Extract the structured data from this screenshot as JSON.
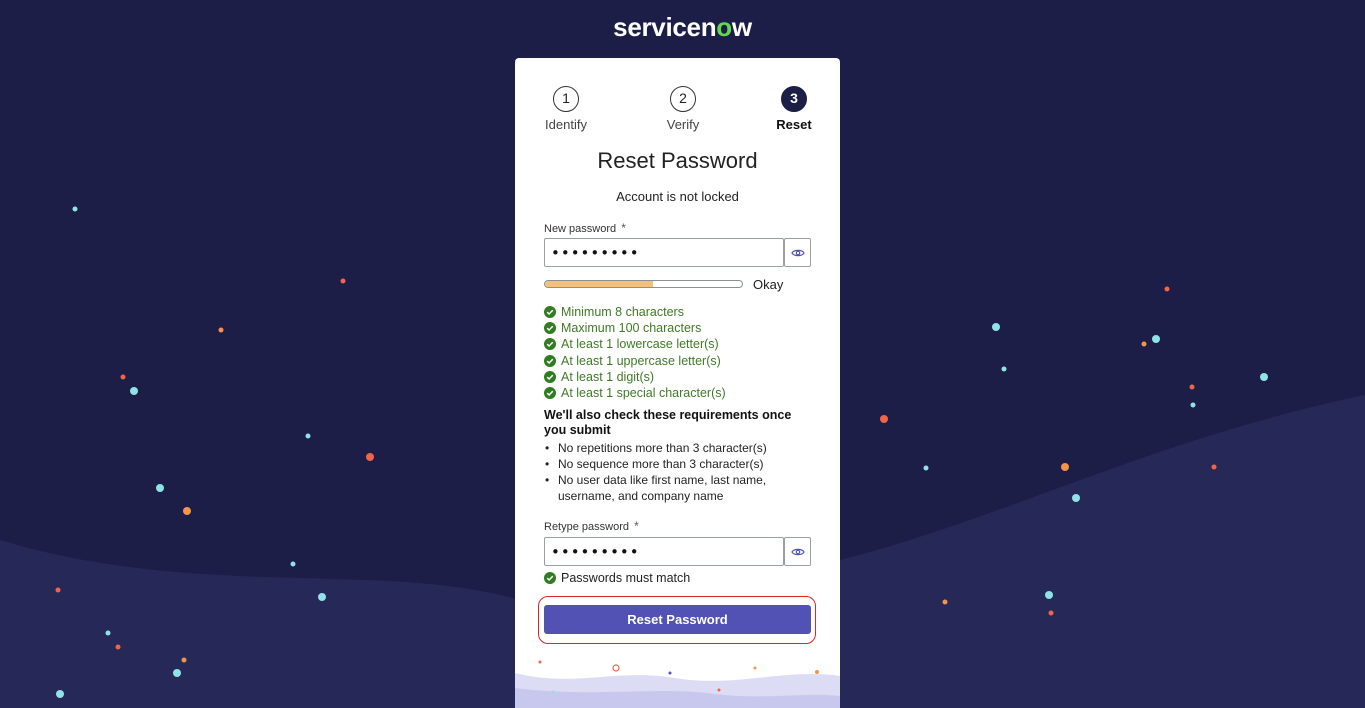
{
  "brand": {
    "name_prefix": "servicen",
    "name_o": "o",
    "name_suffix": "w",
    "accent": "#62d84e"
  },
  "colors": {
    "background": "#1c1e47",
    "button": "#5152b3",
    "check_text": "#3f7b26",
    "strength_fill": "#f3c27a",
    "highlight": "#e02424"
  },
  "steps": [
    {
      "number": "1",
      "label": "Identify",
      "active": false
    },
    {
      "number": "2",
      "label": "Verify",
      "active": false
    },
    {
      "number": "3",
      "label": "Reset",
      "active": true
    }
  ],
  "title": "Reset Password",
  "subtitle": "Account is not locked",
  "new_password": {
    "label": "New password",
    "required_mark": "*",
    "value": "•••••••••",
    "toggle_icon": "eye-icon"
  },
  "strength": {
    "fraction": 0.55,
    "label": "Okay"
  },
  "requirements": [
    {
      "text": "Minimum 8 characters",
      "met": true
    },
    {
      "text": "Maximum 100 characters",
      "met": true
    },
    {
      "text": "At least 1 lowercase letter(s)",
      "met": true
    },
    {
      "text": "At least 1 uppercase letter(s)",
      "met": true
    },
    {
      "text": "At least 1 digit(s)",
      "met": true
    },
    {
      "text": "At least 1 special character(s)",
      "met": true
    }
  ],
  "submit_checks_heading": "We'll also check these requirements once you submit",
  "submit_checks": [
    "No repetitions more than 3 character(s)",
    "No sequence more than 3 character(s)",
    "No user data like first name, last name, username, and company name"
  ],
  "retype_password": {
    "label": "Retype password",
    "required_mark": "*",
    "value": "•••••••••",
    "toggle_icon": "eye-icon"
  },
  "match_text": "Passwords must match",
  "submit_label": "Reset Password"
}
